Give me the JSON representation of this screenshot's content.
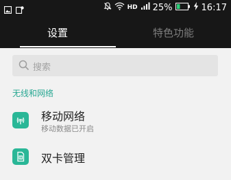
{
  "status_bar": {
    "hd": "HD",
    "battery_percent": "25%",
    "time": "16:17"
  },
  "tabs": [
    {
      "label": "设置",
      "active": true
    },
    {
      "label": "特色功能",
      "active": false
    }
  ],
  "search": {
    "placeholder": "搜索"
  },
  "section": {
    "title": "无线和网络"
  },
  "items": [
    {
      "title": "移动网络",
      "subtitle": "移动数据已开启",
      "icon": "signal-tower-icon"
    },
    {
      "title": "双卡管理",
      "icon": "sim-card-icon"
    }
  ],
  "colors": {
    "header_bg": "#171717",
    "body_bg": "#f2f2f2",
    "accent": "#2ab797",
    "section_text": "#27a792"
  }
}
